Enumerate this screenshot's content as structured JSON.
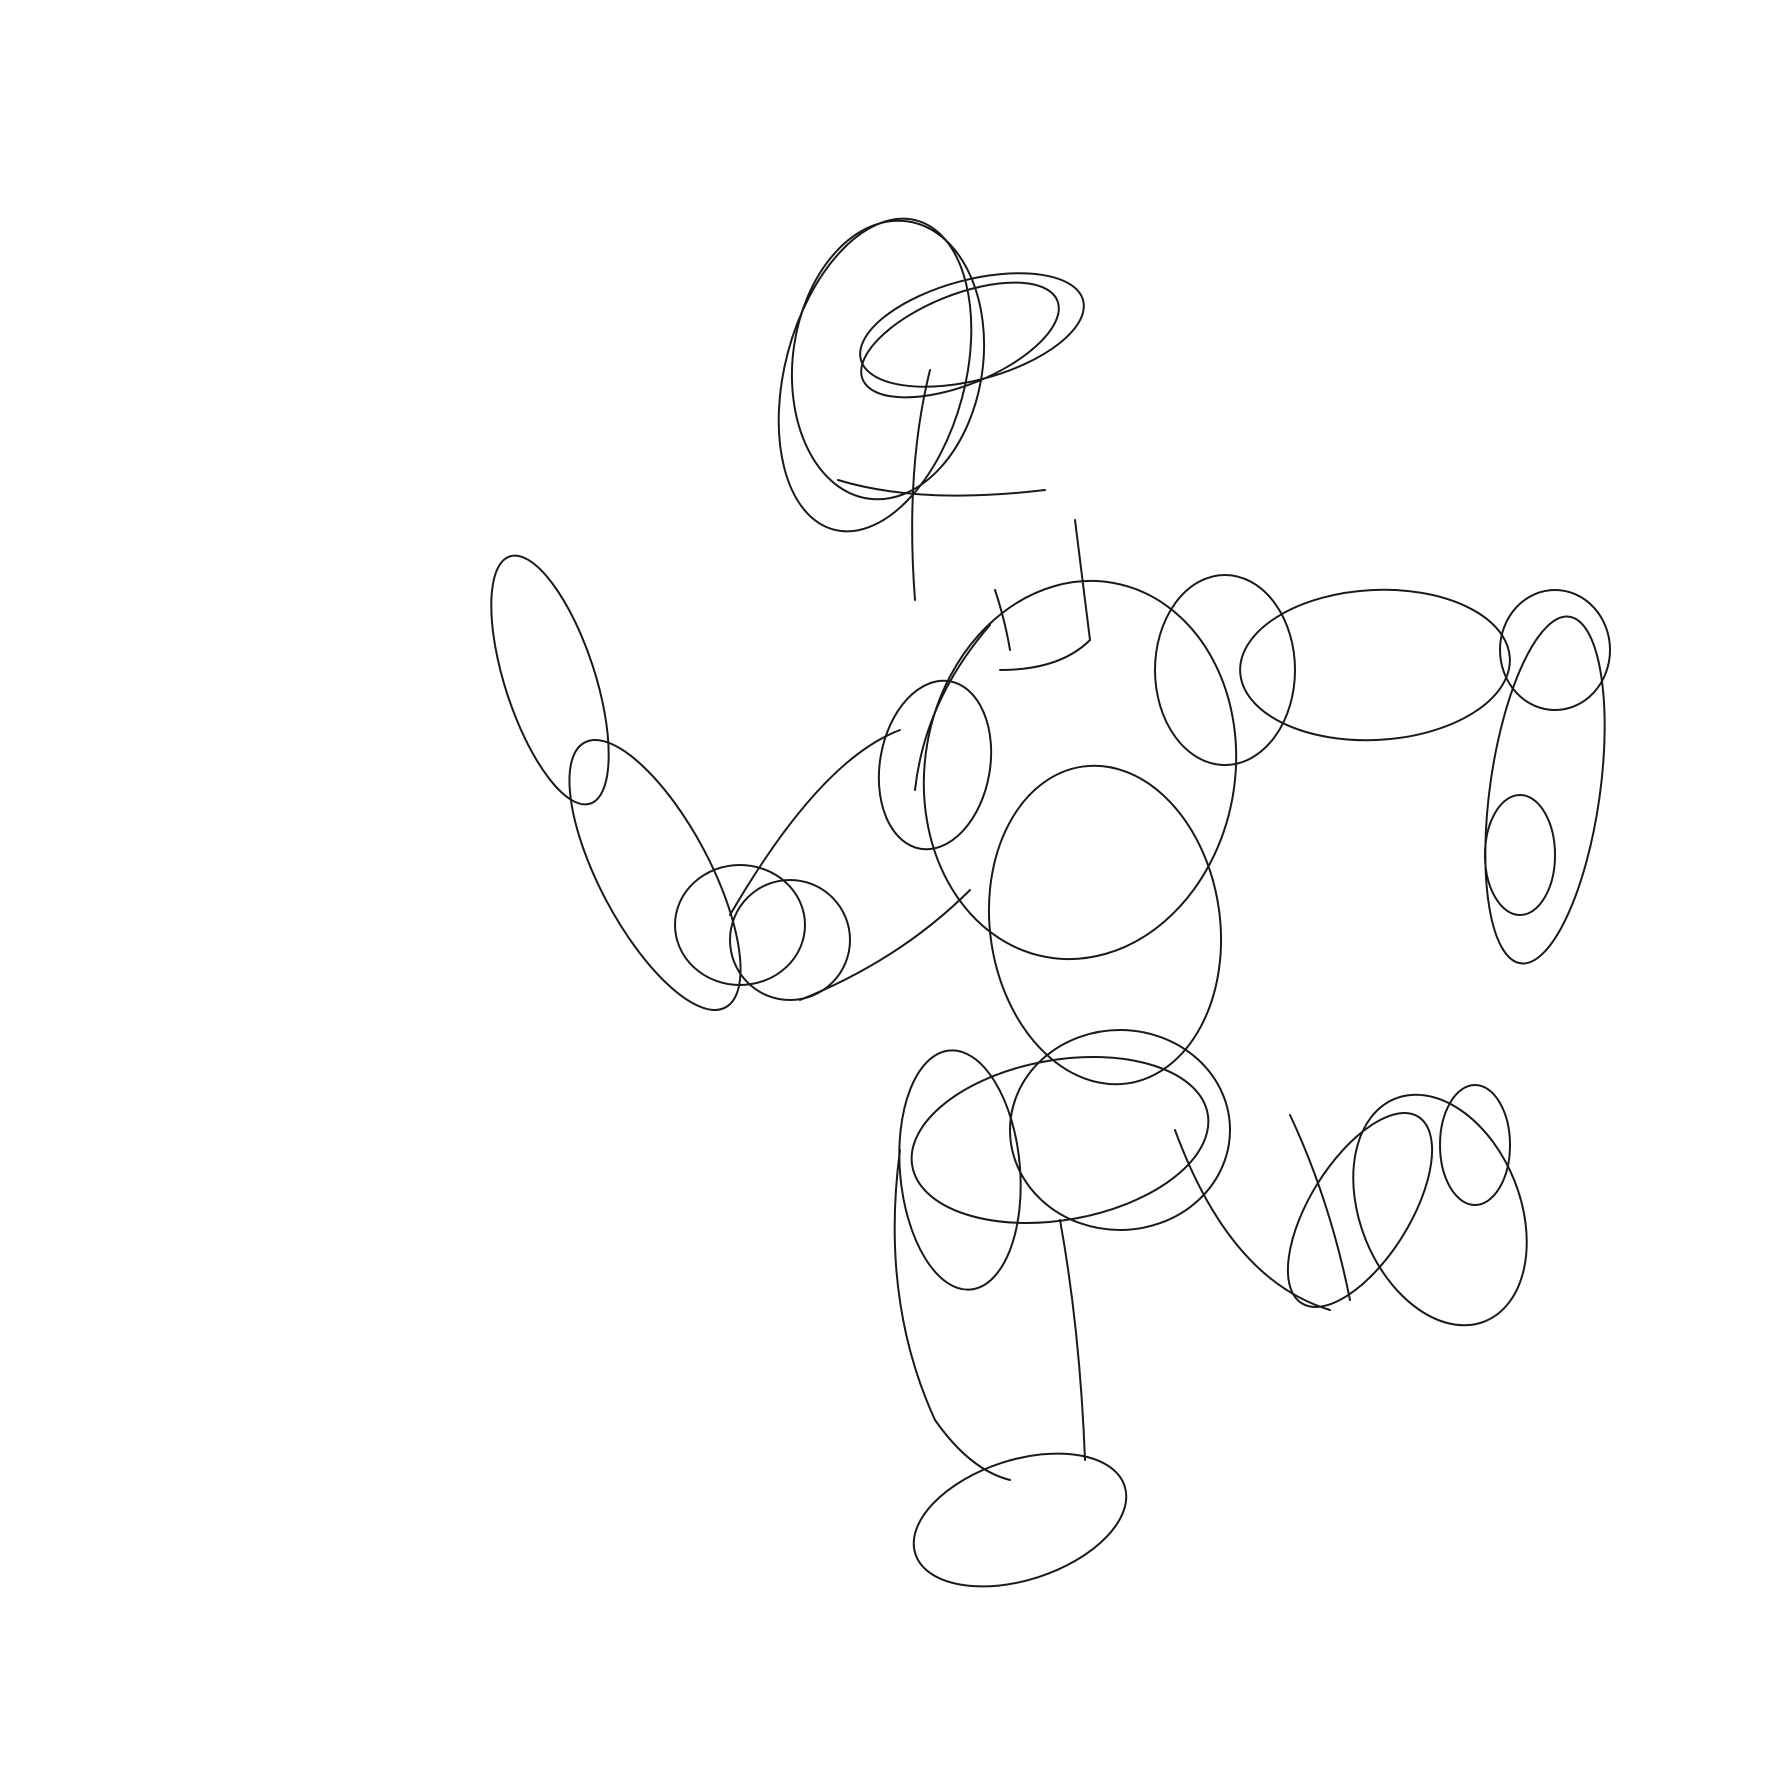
{
  "style": {
    "background": "#ffffff",
    "ink": "#1a1a1a"
  },
  "sketch": {
    "subject": "figure-drawing",
    "parts": [
      "head",
      "neck",
      "torso",
      "pelvis",
      "left-arm",
      "right-arm",
      "left-leg",
      "right-leg"
    ]
  }
}
